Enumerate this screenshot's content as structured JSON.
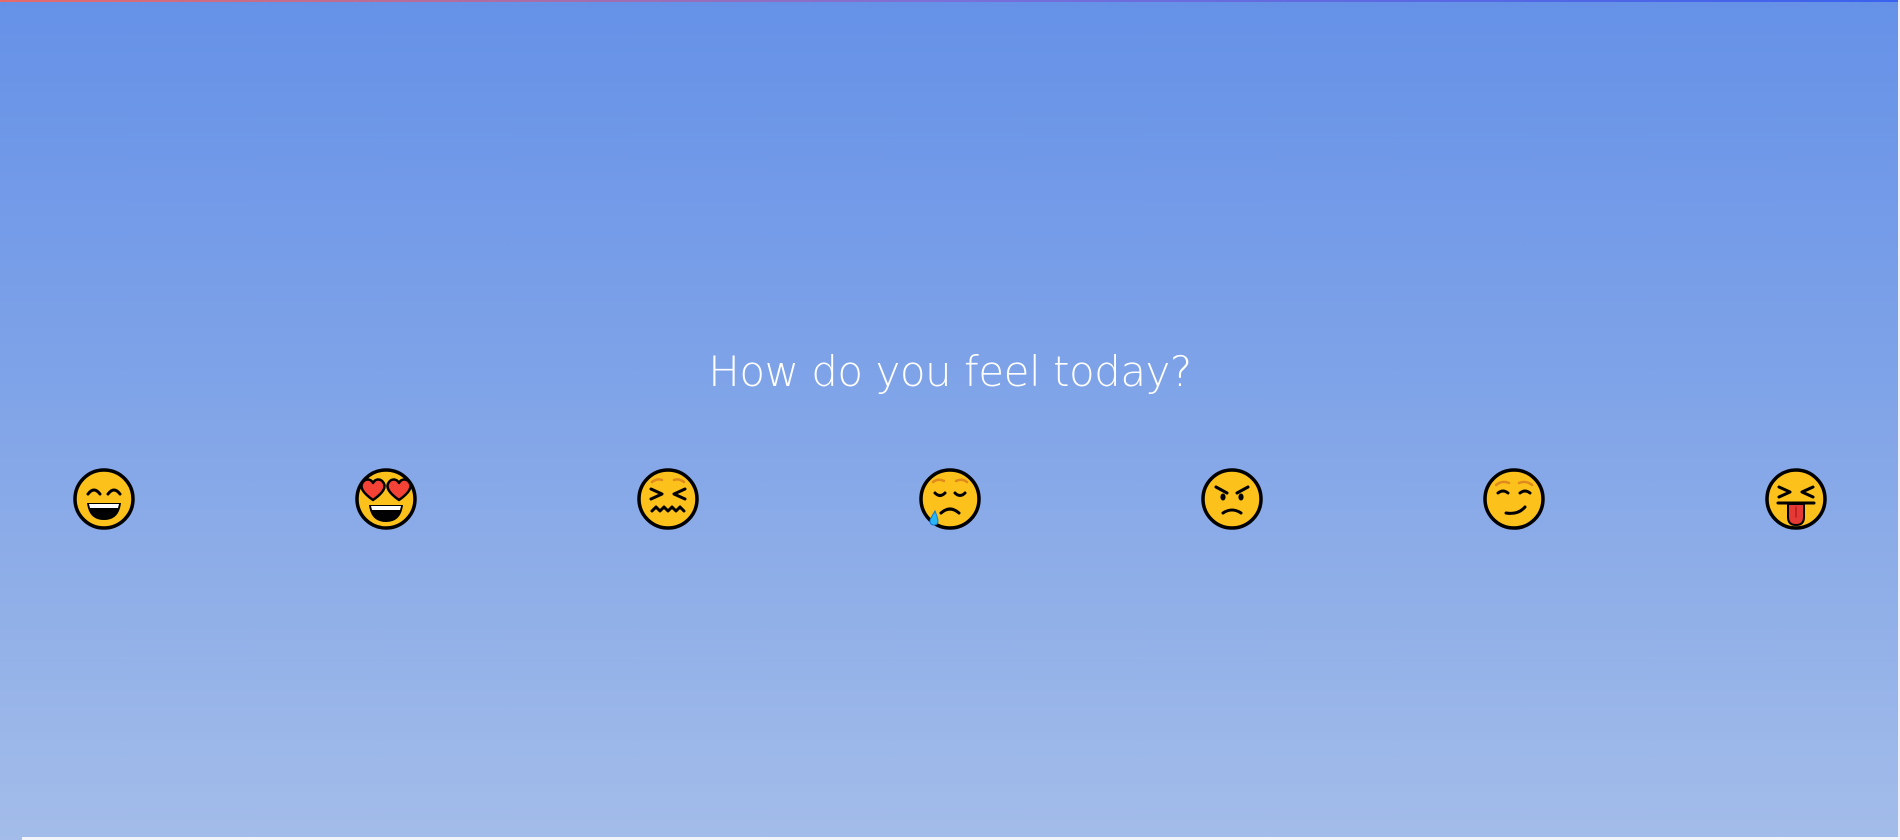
{
  "question": "How do you feel today?",
  "colors": {
    "background_top": "#6591e7",
    "background_bottom": "#a3bce9",
    "emoji_face": "#fcc21b",
    "emoji_outline": "#000000",
    "heart": "#f44336",
    "tongue": "#e53935",
    "tear": "#29b6f6",
    "cheek": "#f0a35a"
  },
  "emojis": [
    {
      "name": "grinning-face-with-smiling-eyes-icon"
    },
    {
      "name": "smiling-face-with-heart-eyes-icon"
    },
    {
      "name": "confounded-face-icon"
    },
    {
      "name": "sleepy-face-icon"
    },
    {
      "name": "angry-face-icon"
    },
    {
      "name": "smirking-face-icon"
    },
    {
      "name": "squinting-face-with-tongue-icon"
    }
  ]
}
